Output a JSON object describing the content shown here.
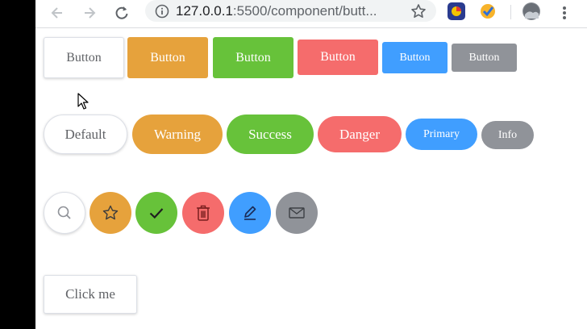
{
  "browser": {
    "url_host": "127.0.0.1",
    "url_rest": ":5500/component/butt...",
    "colors": {
      "chrome_bg": "#ffffff",
      "omnibox_bg": "#f1f3f4",
      "left_strip": "#000000"
    }
  },
  "colors": {
    "warning": "#e6a23c",
    "success": "#67c23a",
    "danger": "#f56c6c",
    "primary": "#409eff",
    "info": "#909399",
    "plain_text": "#606266"
  },
  "row1": {
    "labels": [
      "Button",
      "Button",
      "Button",
      "Button",
      "Button",
      "Button"
    ]
  },
  "row2": {
    "labels": [
      "Default",
      "Warning",
      "Success",
      "Danger",
      "Primary",
      "Info"
    ]
  },
  "row3": {
    "icons": [
      "search-icon",
      "star-icon",
      "check-icon",
      "trash-icon",
      "edit-icon",
      "mail-icon"
    ]
  },
  "row4": {
    "label": "Click me"
  }
}
